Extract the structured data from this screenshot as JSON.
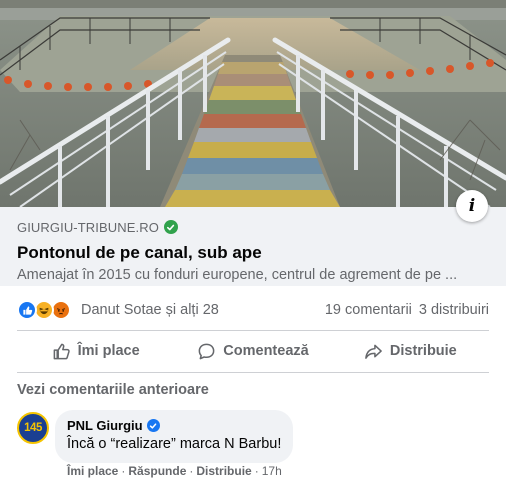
{
  "photo": {
    "image_icon": "photo-of-pontoon-footbridge",
    "info_label": "i"
  },
  "link_preview": {
    "domain": "GIURGIU-TRIBUNE.RO",
    "verified_icon": "green-check-icon",
    "title": "Pontonul de pe canal, sub ape",
    "description": "Amenajat în 2015 cu fonduri europene, centrul de agrement de pe ..."
  },
  "reactions": {
    "icons": [
      "like-icon",
      "haha-icon",
      "angry-icon"
    ],
    "reactors": "Danut Sotae și alți 28",
    "comments_count": "19 comentarii",
    "shares_count": "3 distribuiri"
  },
  "actions": {
    "like": "Îmi place",
    "comment": "Comentează",
    "share": "Distribuie"
  },
  "comments": {
    "view_previous": "Vezi comentariile anterioare",
    "items": [
      {
        "avatar_text": "145",
        "author": "PNL Giurgiu",
        "text": "Încă o “realizare” marca N Barbu!",
        "like": "Îmi place",
        "reply": "Răspunde",
        "share": "Distribuie",
        "time": "17h",
        "separator": "·"
      }
    ]
  },
  "colors": {
    "brand_blue": "#1877f2",
    "verified_green": "#31a24c",
    "secondary_text": "#65676b",
    "preview_bg": "#f0f2f5"
  }
}
